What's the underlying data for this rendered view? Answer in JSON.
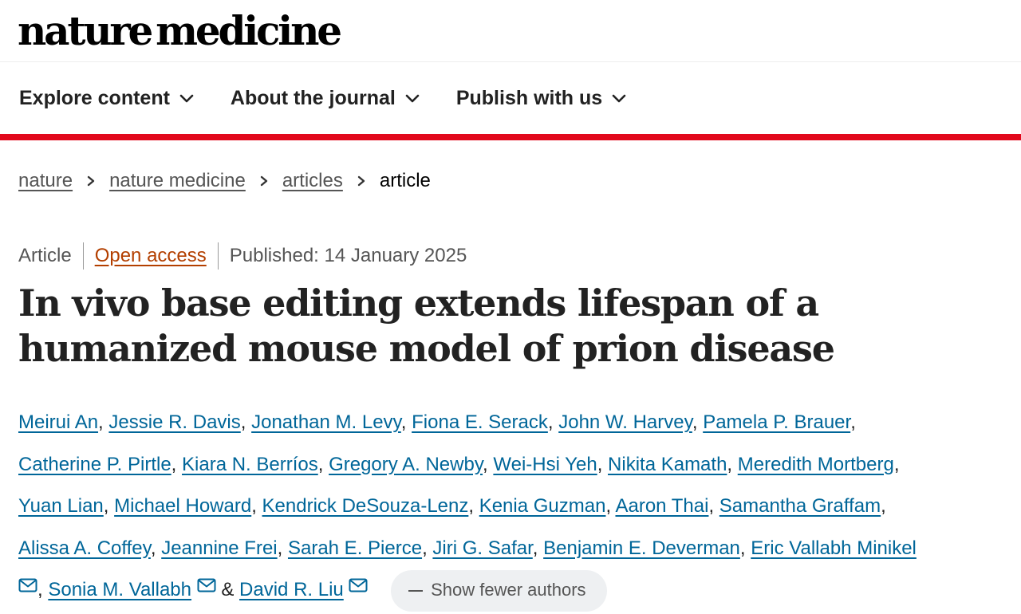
{
  "header": {
    "logo_part1": "nature",
    "logo_part2": "medicine"
  },
  "nav": {
    "items": [
      {
        "label": "Explore content"
      },
      {
        "label": "About the journal"
      },
      {
        "label": "Publish with us"
      }
    ],
    "icon": "chevron-down-icon"
  },
  "breadcrumb": {
    "items": [
      "nature",
      "nature medicine",
      "articles",
      "article"
    ],
    "separator_icon": "chevron-right-icon"
  },
  "article": {
    "type": "Article",
    "access": "Open access",
    "published": "Published: 14 January 2025",
    "title": "In vivo base editing extends lifespan of a humanized mouse model of prion disease"
  },
  "authors": {
    "list": [
      "Meirui An",
      "Jessie R. Davis",
      "Jonathan M. Levy",
      "Fiona E. Serack",
      "John W. Harvey",
      "Pamela P. Brauer",
      "Catherine P. Pirtle",
      "Kiara N. Berríos",
      "Gregory A. Newby",
      "Wei-Hsi Yeh",
      "Nikita Kamath",
      "Meredith Mortberg",
      "Yuan Lian",
      "Michael Howard",
      "Kendrick DeSouza-Lenz",
      "Kenia Guzman",
      "Aaron Thai",
      "Samantha Graffam",
      "Alissa A. Coffey",
      "Jeannine Frei",
      "Sarah E. Pierce",
      "Jiri G. Safar",
      "Benjamin E. Deverman",
      "Eric Vallabh Minikel",
      "Sonia M. Vallabh",
      "David R. Liu"
    ],
    "separator": ", ",
    "ampersand": "& ",
    "show_fewer_label": "Show fewer authors",
    "mail_icon": "envelope-icon"
  },
  "colors": {
    "link": "#006699",
    "accent_red": "#e2081c",
    "open_access": "#b33f00"
  }
}
